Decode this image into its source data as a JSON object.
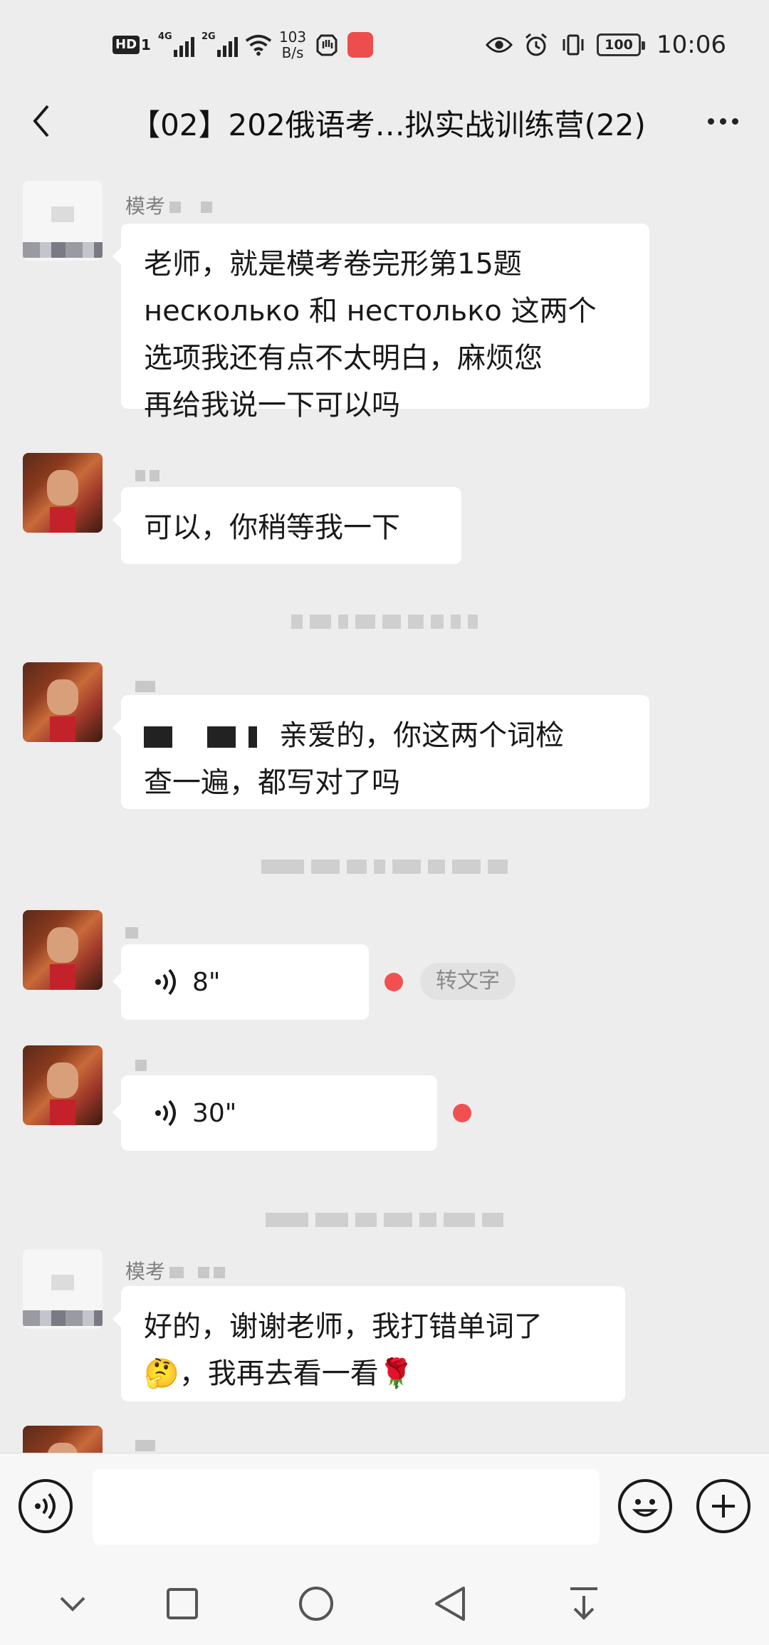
{
  "status_bar": {
    "hd_label": "HD",
    "sim_label": "1",
    "signal1_label": "4G",
    "signal2_label": "2G",
    "net_speed_value": "103",
    "net_speed_unit": "B/s",
    "battery": "100",
    "time": "10:06",
    "app_badge": "HUAWEI"
  },
  "header": {
    "title": "【02】202俄语考…拟实战训练营(22)"
  },
  "messages": [
    {
      "nickname": "模考",
      "text_lines": [
        "老师，就是模考卷完形第15题",
        "несколько 和 нестолько 这两个",
        "选项我还有点不太明白，麻烦您",
        "再给我说一下可以吗"
      ]
    },
    {
      "text": "可以，你稍等我一下"
    },
    {
      "text_line1": "亲爱的，你这两个词检",
      "text_line2": "查一遍，都写对了吗"
    },
    {
      "duration": "8\"",
      "to_text": "转文字"
    },
    {
      "duration": "30\""
    },
    {
      "nickname": "模考",
      "text_line1": "好的，谢谢老师，我打错单词了",
      "text_line2_emoji1": "🤔",
      "text_line2": "，我再去看一看",
      "text_line2_emoji2": "🌹"
    }
  ],
  "colors": {
    "background": "#ededed",
    "bubble": "#ffffff",
    "unread_dot": "#f25050"
  },
  "icons": {
    "back": "chevron-left-icon",
    "more": "more-dots-icon",
    "voice_toggle": "voice-icon",
    "emoji": "smiley-icon",
    "plus": "plus-icon"
  }
}
